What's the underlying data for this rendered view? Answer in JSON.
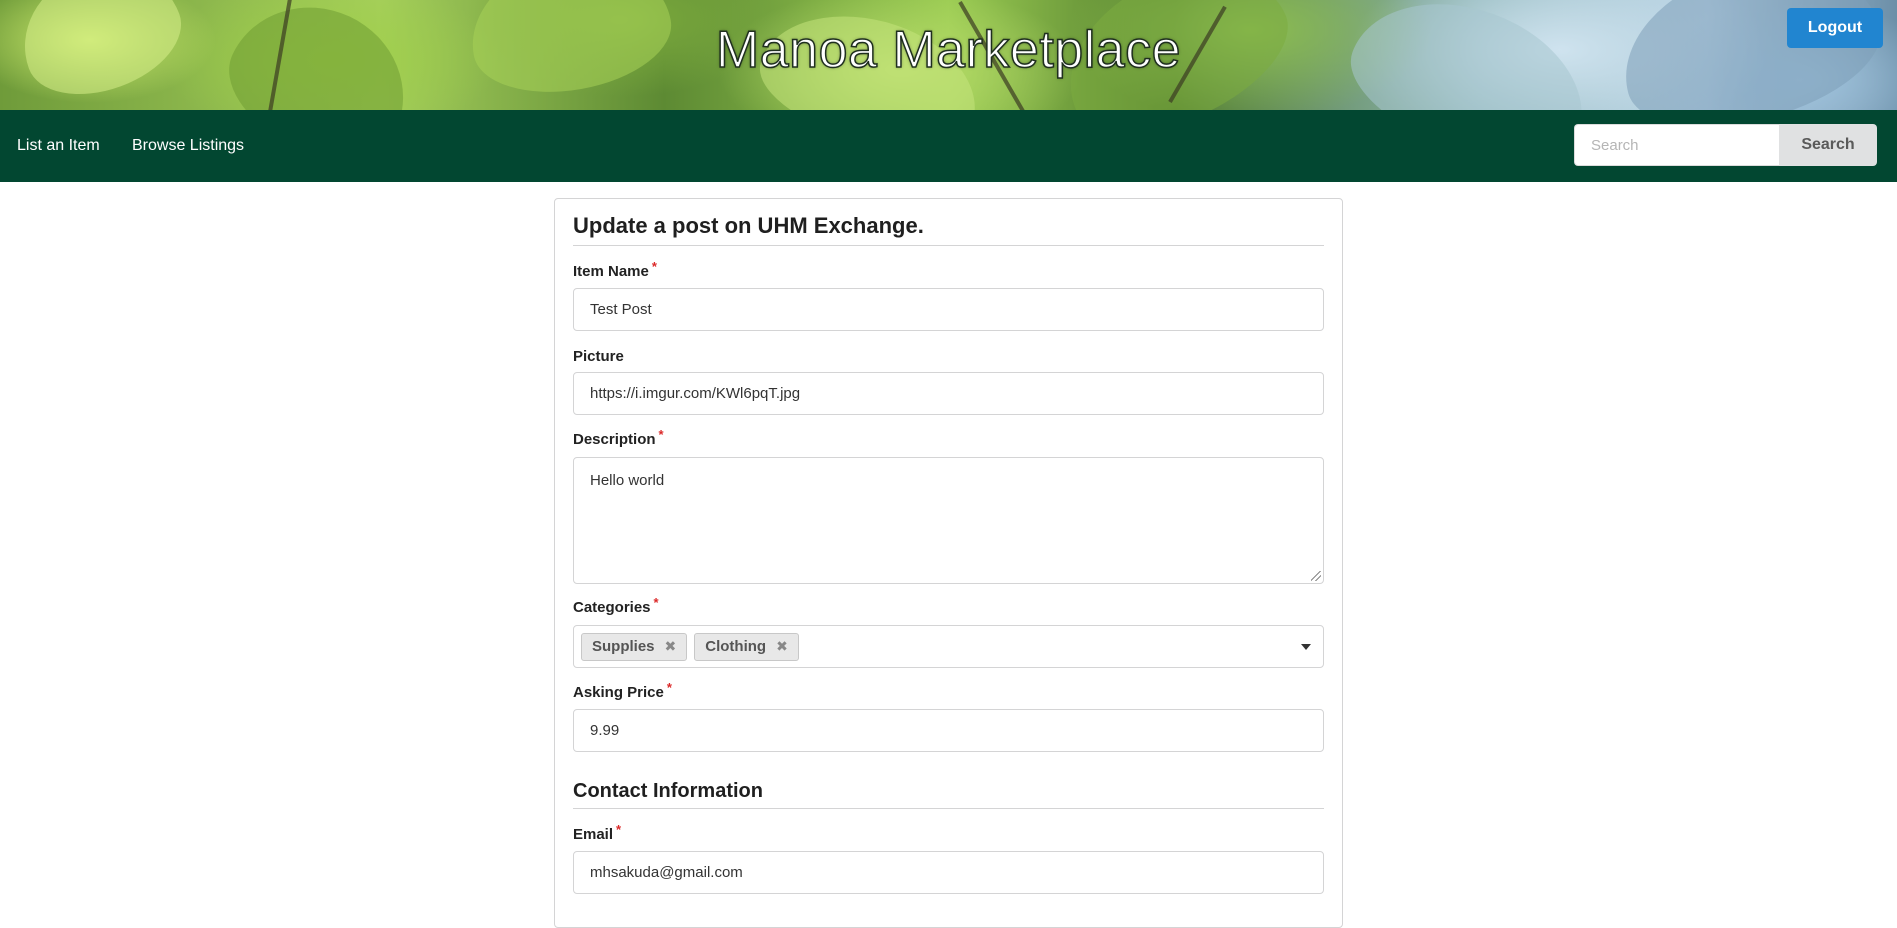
{
  "header": {
    "brand_title": "Manoa Marketplace",
    "logout_label": "Logout"
  },
  "nav": {
    "items": [
      {
        "label": "List an Item"
      },
      {
        "label": "Browse Listings"
      }
    ],
    "search": {
      "placeholder": "Search",
      "button_label": "Search"
    }
  },
  "form": {
    "heading": "Update a post on UHM Exchange.",
    "fields": {
      "item_name": {
        "label": "Item Name",
        "value": "Test Post",
        "required": true
      },
      "picture": {
        "label": "Picture",
        "value": "https://i.imgur.com/KWl6pqT.jpg",
        "required": false
      },
      "description": {
        "label": "Description",
        "value": "Hello world",
        "required": true
      },
      "categories": {
        "label": "Categories",
        "required": true,
        "selected": [
          {
            "label": "Supplies",
            "remove_icon": "close-icon"
          },
          {
            "label": "Clothing",
            "remove_icon": "close-icon"
          }
        ],
        "caret_icon": "caret-down-icon"
      },
      "asking_price": {
        "label": "Asking Price",
        "value": "9.99",
        "required": true
      }
    },
    "contact_heading": "Contact Information",
    "contact_fields": {
      "email": {
        "label": "Email",
        "value": "mhsakuda@gmail.com",
        "required": true
      }
    },
    "required_marker": "*"
  },
  "colors": {
    "nav_bg": "#024731",
    "logout_bg": "#2185d0",
    "required": "#db2828"
  }
}
